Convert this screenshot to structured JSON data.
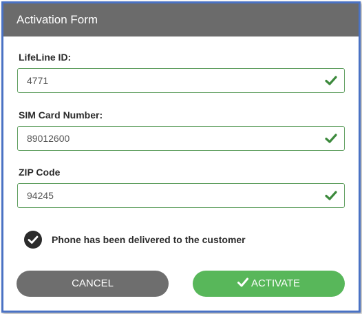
{
  "form": {
    "title": "Activation Form",
    "fields": [
      {
        "label": "LifeLine ID:",
        "value": "4771",
        "valid": true
      },
      {
        "label": "SIM Card Number:",
        "value": "89012600",
        "valid": true
      },
      {
        "label": "ZIP Code",
        "value": "94245",
        "valid": true
      }
    ],
    "confirmation": {
      "checked": true,
      "text": "Phone has been delivered to the customer"
    },
    "buttons": {
      "cancel_label": "CANCEL",
      "activate_label": "ACTIVATE"
    }
  },
  "icons": {
    "field_check": "check-icon",
    "confirmation": "check-circle-icon",
    "activate": "check-icon"
  },
  "colors": {
    "header_bg": "#6b6b6b",
    "frame_border": "#4a72c4",
    "valid_border": "#5e9e5e",
    "check_green": "#3d8a3d",
    "activate_bg": "#58b75a",
    "cancel_bg": "#6e6e6e"
  }
}
